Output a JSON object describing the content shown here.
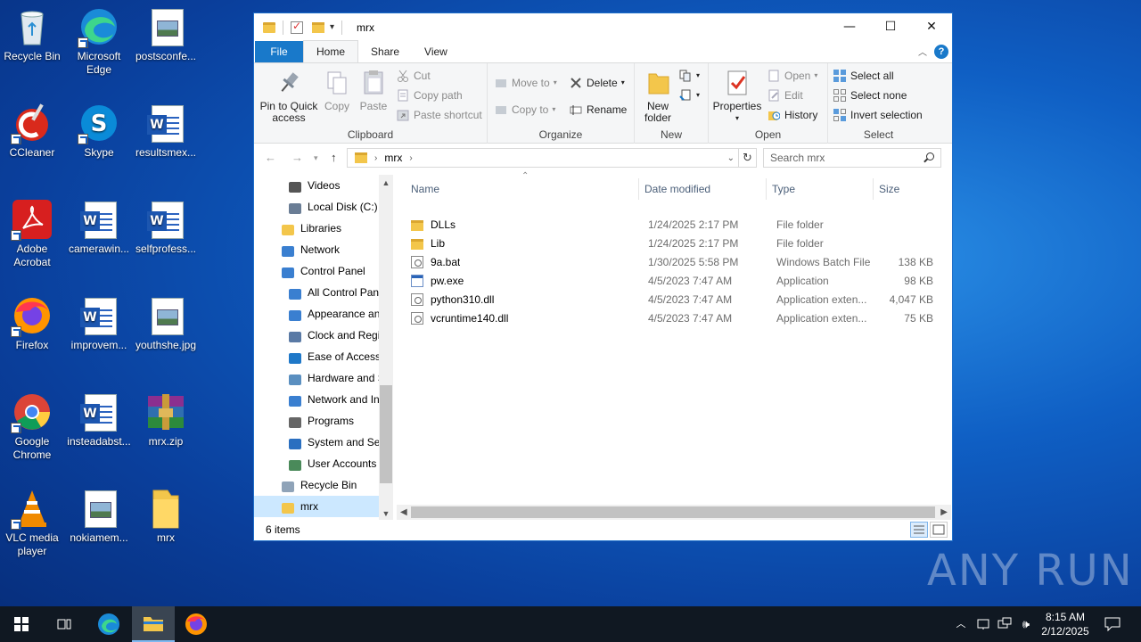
{
  "desktop": {
    "icons": [
      {
        "label": "Recycle Bin",
        "icon": "recycle-bin-icon"
      },
      {
        "label": "Microsoft Edge",
        "icon": "edge-icon"
      },
      {
        "label": "postsconfe...",
        "icon": "image-file-icon"
      },
      {
        "label": "CCleaner",
        "icon": "ccleaner-icon"
      },
      {
        "label": "Skype",
        "icon": "skype-icon"
      },
      {
        "label": "resultsmex...",
        "icon": "word-doc-icon"
      },
      {
        "label": "Adobe Acrobat",
        "icon": "acrobat-icon"
      },
      {
        "label": "camerawin...",
        "icon": "word-doc-icon"
      },
      {
        "label": "selfprofess...",
        "icon": "word-doc-icon"
      },
      {
        "label": "Firefox",
        "icon": "firefox-icon"
      },
      {
        "label": "improvem...",
        "icon": "word-doc-icon"
      },
      {
        "label": "youthshe.jpg",
        "icon": "image-file-icon"
      },
      {
        "label": "Google Chrome",
        "icon": "chrome-icon"
      },
      {
        "label": "insteadabst...",
        "icon": "word-doc-icon"
      },
      {
        "label": "mrx.zip",
        "icon": "winrar-icon"
      },
      {
        "label": "VLC media player",
        "icon": "vlc-icon"
      },
      {
        "label": "nokiamem...",
        "icon": "image-file-icon"
      },
      {
        "label": "mrx",
        "icon": "folder-icon"
      }
    ]
  },
  "window": {
    "title": "mrx",
    "controls": {
      "minimize": "—",
      "maximize": "☐",
      "close": "✕"
    }
  },
  "tabs": {
    "file": "File",
    "home": "Home",
    "share": "Share",
    "view": "View",
    "help": "?"
  },
  "ribbon": {
    "clipboard": {
      "pin": "Pin to Quick access",
      "copy": "Copy",
      "paste": "Paste",
      "cut": "Cut",
      "copy_path": "Copy path",
      "paste_shortcut": "Paste shortcut",
      "label": "Clipboard"
    },
    "organize": {
      "move_to": "Move to",
      "copy_to": "Copy to",
      "delete": "Delete",
      "rename": "Rename",
      "label": "Organize"
    },
    "new": {
      "new_folder": "New folder",
      "label": "New"
    },
    "open": {
      "properties": "Properties",
      "open": "Open",
      "edit": "Edit",
      "history": "History",
      "label": "Open"
    },
    "select": {
      "select_all": "Select all",
      "select_none": "Select none",
      "invert": "Invert selection",
      "label": "Select"
    }
  },
  "address": {
    "path": "mrx",
    "search_placeholder": "Search mrx"
  },
  "nav": {
    "items": [
      {
        "label": "Videos",
        "indent": 1
      },
      {
        "label": "Local Disk (C:)",
        "indent": 1
      },
      {
        "label": "Libraries",
        "indent": 0
      },
      {
        "label": "Network",
        "indent": 0
      },
      {
        "label": "Control Panel",
        "indent": 0
      },
      {
        "label": "All Control Panel Items",
        "indent": 1
      },
      {
        "label": "Appearance and Personalization",
        "indent": 1
      },
      {
        "label": "Clock and Region",
        "indent": 1
      },
      {
        "label": "Ease of Access",
        "indent": 1
      },
      {
        "label": "Hardware and Sound",
        "indent": 1
      },
      {
        "label": "Network and Internet",
        "indent": 1
      },
      {
        "label": "Programs",
        "indent": 1
      },
      {
        "label": "System and Security",
        "indent": 1
      },
      {
        "label": "User Accounts",
        "indent": 1
      },
      {
        "label": "Recycle Bin",
        "indent": 0
      },
      {
        "label": "mrx",
        "indent": 0
      }
    ]
  },
  "columns": {
    "name": "Name",
    "date": "Date modified",
    "type": "Type",
    "size": "Size"
  },
  "files": [
    {
      "name": "DLLs",
      "date": "1/24/2025 2:17 PM",
      "type": "File folder",
      "size": "",
      "kind": "folder"
    },
    {
      "name": "Lib",
      "date": "1/24/2025 2:17 PM",
      "type": "File folder",
      "size": "",
      "kind": "folder"
    },
    {
      "name": "9a.bat",
      "date": "1/30/2025 5:58 PM",
      "type": "Windows Batch File",
      "size": "138 KB",
      "kind": "bat"
    },
    {
      "name": "pw.exe",
      "date": "4/5/2023 7:47 AM",
      "type": "Application",
      "size": "98 KB",
      "kind": "exe"
    },
    {
      "name": "python310.dll",
      "date": "4/5/2023 7:47 AM",
      "type": "Application exten...",
      "size": "4,047 KB",
      "kind": "dll"
    },
    {
      "name": "vcruntime140.dll",
      "date": "4/5/2023 7:47 AM",
      "type": "Application exten...",
      "size": "75 KB",
      "kind": "dll"
    }
  ],
  "status": {
    "count": "6 items"
  },
  "taskbar": {
    "apps": [
      "start-icon",
      "task-view-icon",
      "edge-icon",
      "file-explorer-icon",
      "firefox-icon"
    ],
    "time": "8:15 AM",
    "date": "2/12/2025"
  },
  "watermark": "ANY RUN"
}
